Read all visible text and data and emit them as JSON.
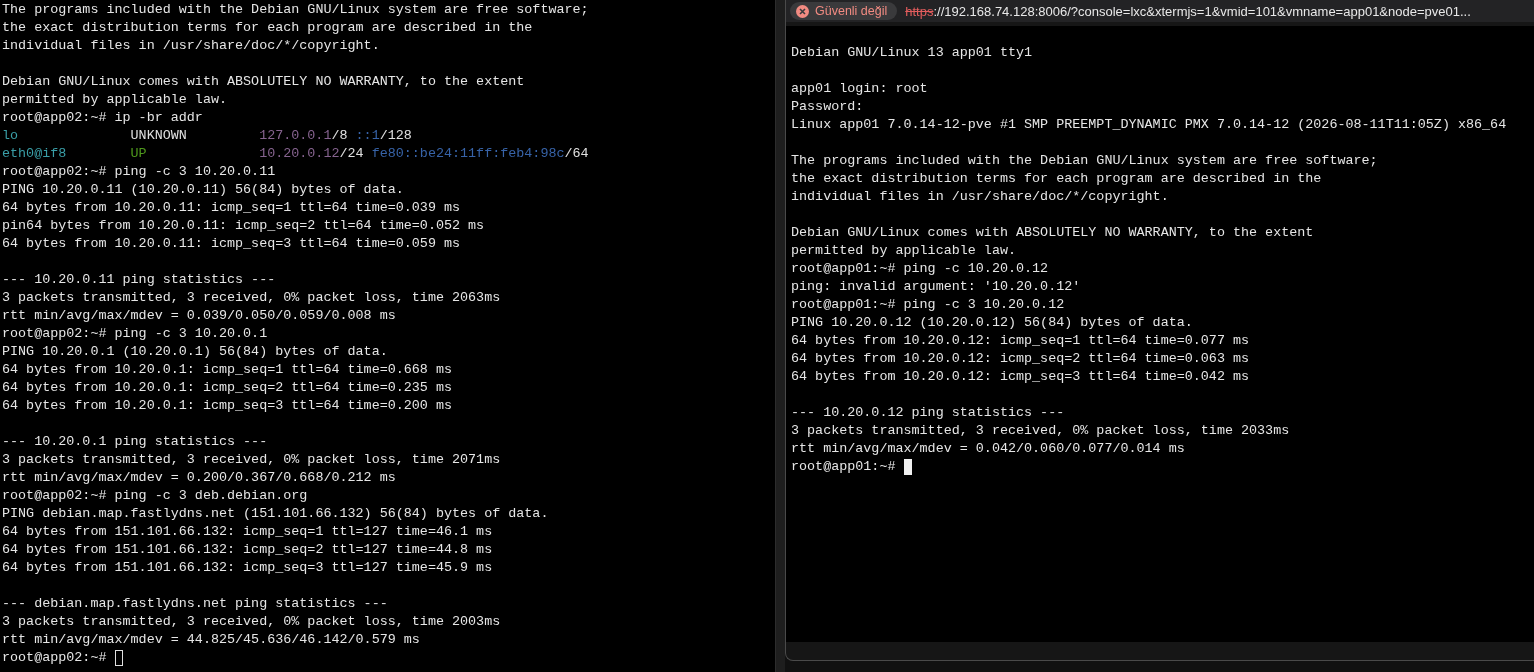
{
  "left_terminal": {
    "focused": false,
    "lines": [
      {
        "kind": "text",
        "text": "The programs included with the Debian GNU/Linux system are free software;"
      },
      {
        "kind": "text",
        "text": "the exact distribution terms for each program are described in the"
      },
      {
        "kind": "text",
        "text": "individual files in /usr/share/doc/*/copyright."
      },
      {
        "kind": "blank"
      },
      {
        "kind": "text",
        "text": "Debian GNU/Linux comes with ABSOLUTELY NO WARRANTY, to the extent"
      },
      {
        "kind": "text",
        "text": "permitted by applicable law."
      },
      {
        "kind": "text",
        "text": "root@app02:~# ip -br addr"
      },
      {
        "kind": "ip-brief",
        "iface": {
          "text": "lo",
          "color": "#3a9fa8"
        },
        "state": {
          "text": "UNKNOWN",
          "color": "#e0e0e0"
        },
        "addresses": [
          {
            "text": "127.0.0.1",
            "color": "#86638f"
          },
          {
            "text": "/8 ",
            "color": "#e0e0e0"
          },
          {
            "text": "::1",
            "color": "#3763a8"
          },
          {
            "text": "/128",
            "color": "#e0e0e0"
          }
        ]
      },
      {
        "kind": "ip-brief",
        "iface": {
          "text": "eth0@if8",
          "color": "#3a9fa8"
        },
        "state": {
          "text": "UP",
          "color": "#4f9a1c"
        },
        "addresses": [
          {
            "text": "10.20.0.12",
            "color": "#86638f"
          },
          {
            "text": "/24 ",
            "color": "#e0e0e0"
          },
          {
            "text": "fe80::be24:11ff:feb4:98c",
            "color": "#3763a8"
          },
          {
            "text": "/64",
            "color": "#e0e0e0"
          }
        ]
      },
      {
        "kind": "text",
        "text": "root@app02:~# ping -c 3 10.20.0.11"
      },
      {
        "kind": "text",
        "text": "PING 10.20.0.11 (10.20.0.11) 56(84) bytes of data."
      },
      {
        "kind": "text",
        "text": "64 bytes from 10.20.0.11: icmp_seq=1 ttl=64 time=0.039 ms"
      },
      {
        "kind": "text",
        "text": "pin64 bytes from 10.20.0.11: icmp_seq=2 ttl=64 time=0.052 ms"
      },
      {
        "kind": "text",
        "text": "64 bytes from 10.20.0.11: icmp_seq=3 ttl=64 time=0.059 ms"
      },
      {
        "kind": "blank"
      },
      {
        "kind": "text",
        "text": "--- 10.20.0.11 ping statistics ---"
      },
      {
        "kind": "text",
        "text": "3 packets transmitted, 3 received, 0% packet loss, time 2063ms"
      },
      {
        "kind": "text",
        "text": "rtt min/avg/max/mdev = 0.039/0.050/0.059/0.008 ms"
      },
      {
        "kind": "text",
        "text": "root@app02:~# ping -c 3 10.20.0.1"
      },
      {
        "kind": "text",
        "text": "PING 10.20.0.1 (10.20.0.1) 56(84) bytes of data."
      },
      {
        "kind": "text",
        "text": "64 bytes from 10.20.0.1: icmp_seq=1 ttl=64 time=0.668 ms"
      },
      {
        "kind": "text",
        "text": "64 bytes from 10.20.0.1: icmp_seq=2 ttl=64 time=0.235 ms"
      },
      {
        "kind": "text",
        "text": "64 bytes from 10.20.0.1: icmp_seq=3 ttl=64 time=0.200 ms"
      },
      {
        "kind": "blank"
      },
      {
        "kind": "text",
        "text": "--- 10.20.0.1 ping statistics ---"
      },
      {
        "kind": "text",
        "text": "3 packets transmitted, 3 received, 0% packet loss, time 2071ms"
      },
      {
        "kind": "text",
        "text": "rtt min/avg/max/mdev = 0.200/0.367/0.668/0.212 ms"
      },
      {
        "kind": "text",
        "text": "root@app02:~# ping -c 3 deb.debian.org"
      },
      {
        "kind": "text",
        "text": "PING debian.map.fastlydns.net (151.101.66.132) 56(84) bytes of data."
      },
      {
        "kind": "text",
        "text": "64 bytes from 151.101.66.132: icmp_seq=1 ttl=127 time=46.1 ms"
      },
      {
        "kind": "text",
        "text": "64 bytes from 151.101.66.132: icmp_seq=2 ttl=127 time=44.8 ms"
      },
      {
        "kind": "text",
        "text": "64 bytes from 151.101.66.132: icmp_seq=3 ttl=127 time=45.9 ms"
      },
      {
        "kind": "blank"
      },
      {
        "kind": "text",
        "text": "--- debian.map.fastlydns.net ping statistics ---"
      },
      {
        "kind": "text",
        "text": "3 packets transmitted, 3 received, 0% packet loss, time 2003ms"
      },
      {
        "kind": "text",
        "text": "rtt min/avg/max/mdev = 44.825/45.636/46.142/0.579 ms"
      },
      {
        "kind": "prompt",
        "text": "root@app02:~#"
      }
    ]
  },
  "browser_window": {
    "security_badge": "Güvenli değil",
    "url_scheme": "https",
    "url_rest": "://192.168.74.128:8006/?console=lxc&xtermjs=1&vmid=101&vmname=app01&node=pve01...",
    "terminal": {
      "focused": true,
      "lines": [
        {
          "kind": "blank"
        },
        {
          "kind": "text",
          "text": "Debian GNU/Linux 13 app01 tty1"
        },
        {
          "kind": "blank"
        },
        {
          "kind": "text",
          "text": "app01 login: root"
        },
        {
          "kind": "text",
          "text": "Password:"
        },
        {
          "kind": "text",
          "text": "Linux app01 7.0.14-12-pve #1 SMP PREEMPT_DYNAMIC PMX 7.0.14-12 (2026-08-11T11:05Z) x86_64"
        },
        {
          "kind": "blank"
        },
        {
          "kind": "text",
          "text": "The programs included with the Debian GNU/Linux system are free software;"
        },
        {
          "kind": "text",
          "text": "the exact distribution terms for each program are described in the"
        },
        {
          "kind": "text",
          "text": "individual files in /usr/share/doc/*/copyright."
        },
        {
          "kind": "blank"
        },
        {
          "kind": "text",
          "text": "Debian GNU/Linux comes with ABSOLUTELY NO WARRANTY, to the extent"
        },
        {
          "kind": "text",
          "text": "permitted by applicable law."
        },
        {
          "kind": "text",
          "text": "root@app01:~# ping -c 10.20.0.12"
        },
        {
          "kind": "text",
          "text": "ping: invalid argument: '10.20.0.12'"
        },
        {
          "kind": "text",
          "text": "root@app01:~# ping -c 3 10.20.0.12"
        },
        {
          "kind": "text",
          "text": "PING 10.20.0.12 (10.20.0.12) 56(84) bytes of data."
        },
        {
          "kind": "text",
          "text": "64 bytes from 10.20.0.12: icmp_seq=1 ttl=64 time=0.077 ms"
        },
        {
          "kind": "text",
          "text": "64 bytes from 10.20.0.12: icmp_seq=2 ttl=64 time=0.063 ms"
        },
        {
          "kind": "text",
          "text": "64 bytes from 10.20.0.12: icmp_seq=3 ttl=64 time=0.042 ms"
        },
        {
          "kind": "blank"
        },
        {
          "kind": "text",
          "text": "--- 10.20.0.12 ping statistics ---"
        },
        {
          "kind": "text",
          "text": "3 packets transmitted, 3 received, 0% packet loss, time 2033ms"
        },
        {
          "kind": "text",
          "text": "rtt min/avg/max/mdev = 0.042/0.060/0.077/0.014 ms"
        },
        {
          "kind": "prompt",
          "text": "root@app01:~#"
        }
      ]
    }
  }
}
